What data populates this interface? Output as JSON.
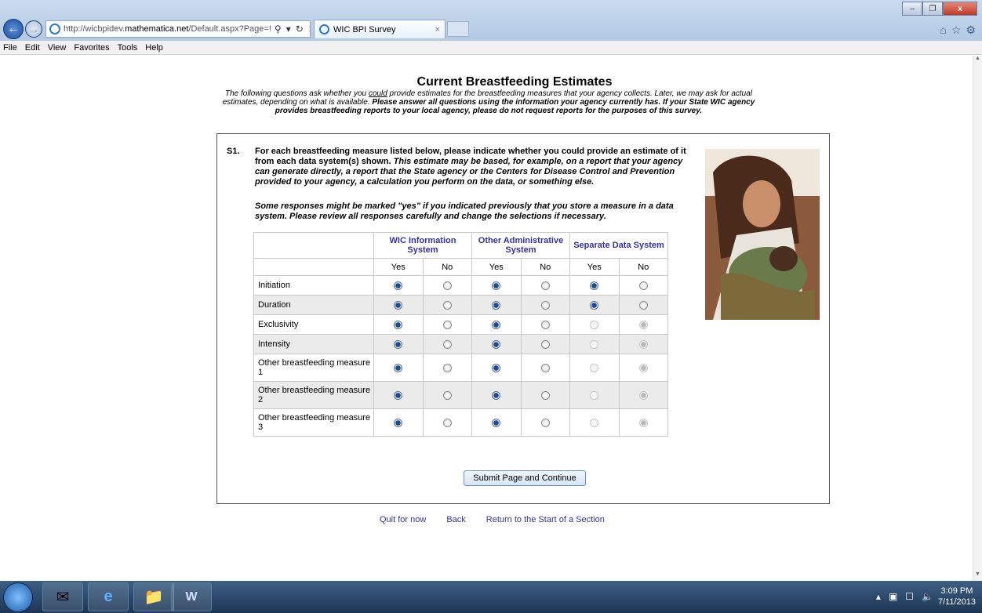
{
  "browser": {
    "url_prefix": "http://wicbpidev.",
    "url_host": "mathematica.net",
    "url_rest": "/Default.aspx?Page=!",
    "tab_title": "WIC BPI Survey",
    "tab_close": "×",
    "menu": [
      "File",
      "Edit",
      "View",
      "Favorites",
      "Tools",
      "Help"
    ]
  },
  "page": {
    "heading": "Current Breastfeeding Estimates",
    "intro_1": "The following questions ask whether you ",
    "intro_could": "could",
    "intro_2": " provide estimates for the breastfeeding measures that your agency collects. Later, we may ask for actual estimates, depending on what is available. ",
    "intro_bold": "Please answer all questions using the information your agency currently has. If your State WIC agency provides breastfeeding reports to your local agency, please do not request reports for the purposes of this survey."
  },
  "question": {
    "number": "S1.",
    "text_bold": "For each breastfeeding measure listed below, please indicate whether you could provide an estimate of it from each data system(s) shown. ",
    "text_bold_italic": "This estimate may be based, for example, on a report that your agency can generate directly, a report that the State agency or the Centers for Disease Control and Prevention provided to your agency, a calculation you perform on the data, or something else.",
    "note": "Some responses might be marked \"yes\" if you indicated previously that you store a measure in a data system. Please review all responses carefully and change the selections if necessary."
  },
  "grid": {
    "systems": [
      "WIC Information System",
      "Other Administrative System",
      "Separate Data System"
    ],
    "yes_label": "Yes",
    "no_label": "No",
    "rows": [
      {
        "label": "Initiation",
        "answers": [
          "yes",
          "yes",
          "yes"
        ],
        "disabled_third": false
      },
      {
        "label": "Duration",
        "answers": [
          "yes",
          "yes",
          "yes"
        ],
        "disabled_third": false
      },
      {
        "label": "Exclusivity",
        "answers": [
          "yes",
          "yes",
          "no"
        ],
        "disabled_third": true
      },
      {
        "label": "Intensity",
        "answers": [
          "yes",
          "yes",
          "no"
        ],
        "disabled_third": true
      },
      {
        "label": "Other breastfeeding measure 1",
        "answers": [
          "yes",
          "yes",
          "no"
        ],
        "disabled_third": true
      },
      {
        "label": "Other breastfeeding measure 2",
        "answers": [
          "yes",
          "yes",
          "no"
        ],
        "disabled_third": true
      },
      {
        "label": "Other breastfeeding measure 3",
        "answers": [
          "yes",
          "yes",
          "no"
        ],
        "disabled_third": true
      }
    ]
  },
  "actions": {
    "submit": "Submit Page and Continue",
    "quit": "Quit for now",
    "back": "Back",
    "return": "Return to the Start of a Section"
  },
  "taskbar": {
    "time": "3:09 PM",
    "date": "7/11/2013"
  }
}
